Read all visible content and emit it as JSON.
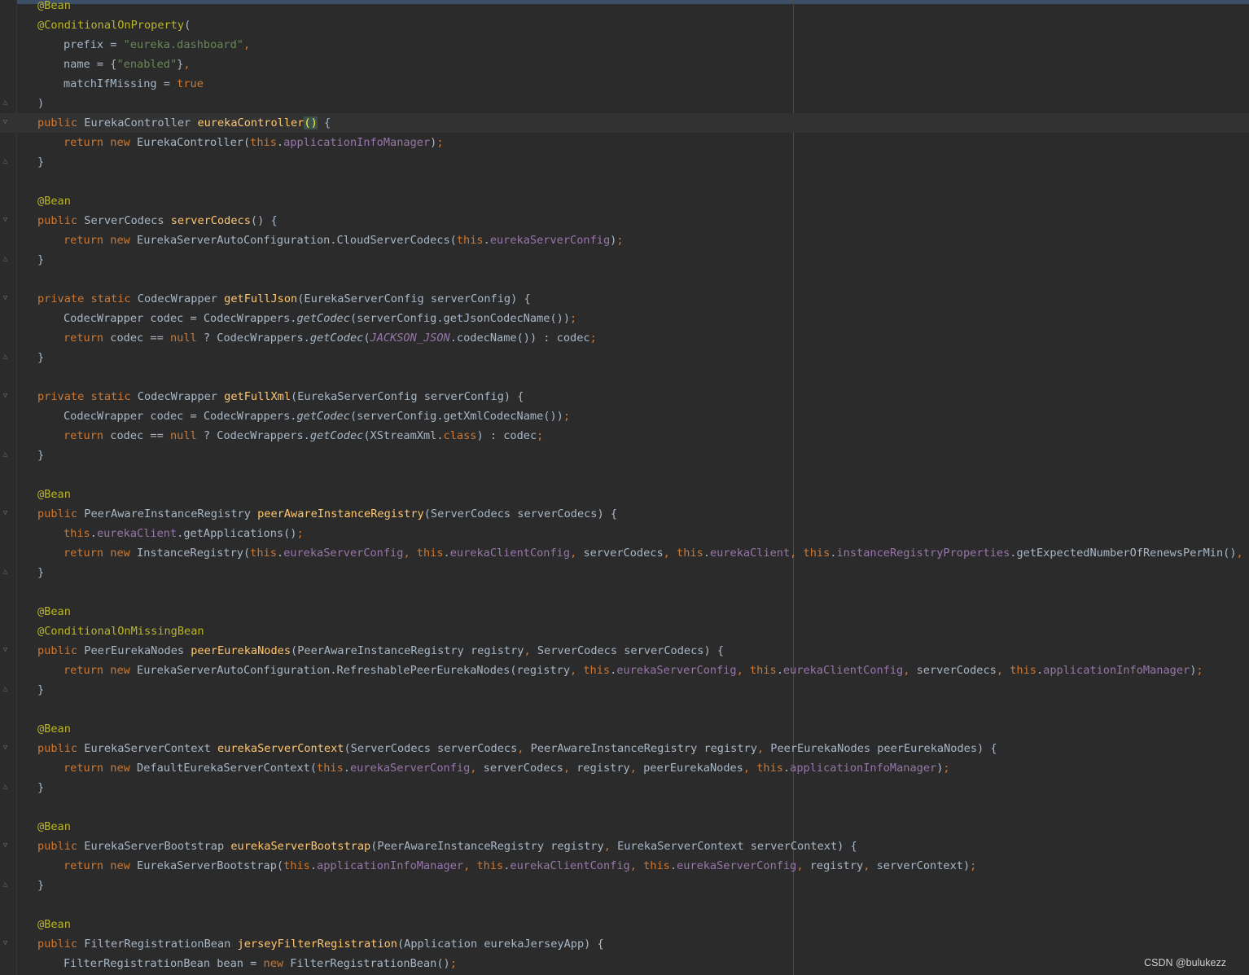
{
  "editor": {
    "current_line_index": 6,
    "lines": [
      {
        "indent": 0,
        "fold": "",
        "tokens": [
          [
            "ann",
            "@Bean"
          ]
        ]
      },
      {
        "indent": 0,
        "fold": "",
        "tokens": [
          [
            "ann",
            "@ConditionalOnProperty"
          ],
          [
            "",
            "("
          ]
        ]
      },
      {
        "indent": 1,
        "fold": "",
        "tokens": [
          [
            "",
            "prefix = "
          ],
          [
            "str",
            "\"eureka.dashboard\""
          ],
          [
            "kw",
            ","
          ]
        ]
      },
      {
        "indent": 1,
        "fold": "",
        "tokens": [
          [
            "",
            "name = {"
          ],
          [
            "str",
            "\"enabled\""
          ],
          [
            "",
            "}"
          ],
          [
            "kw",
            ","
          ]
        ]
      },
      {
        "indent": 1,
        "fold": "",
        "tokens": [
          [
            "",
            "matchIfMissing = "
          ],
          [
            "kw",
            "true"
          ]
        ]
      },
      {
        "indent": 0,
        "fold": "close",
        "tokens": [
          [
            "",
            ")"
          ]
        ]
      },
      {
        "indent": 0,
        "fold": "open",
        "tokens": [
          [
            "kw",
            "public "
          ],
          [
            "",
            "EurekaController "
          ],
          [
            "fn",
            "eurekaController"
          ],
          [
            "br",
            "()"
          ],
          [
            "",
            " {"
          ]
        ]
      },
      {
        "indent": 1,
        "fold": "",
        "tokens": [
          [
            "kw",
            "return new "
          ],
          [
            "",
            "EurekaController("
          ],
          [
            "kw",
            "this"
          ],
          [
            "",
            "."
          ],
          [
            "fld",
            "applicationInfoManager"
          ],
          [
            "",
            ")"
          ],
          [
            "kw",
            ";"
          ]
        ]
      },
      {
        "indent": 0,
        "fold": "close",
        "tokens": [
          [
            "",
            "}"
          ]
        ]
      },
      {
        "indent": 0,
        "fold": "",
        "tokens": []
      },
      {
        "indent": 0,
        "fold": "",
        "tokens": [
          [
            "ann",
            "@Bean"
          ]
        ]
      },
      {
        "indent": 0,
        "fold": "open",
        "tokens": [
          [
            "kw",
            "public "
          ],
          [
            "",
            "ServerCodecs "
          ],
          [
            "fn",
            "serverCodecs"
          ],
          [
            "",
            "() {"
          ]
        ]
      },
      {
        "indent": 1,
        "fold": "",
        "tokens": [
          [
            "kw",
            "return new "
          ],
          [
            "",
            "EurekaServerAutoConfiguration.CloudServerCodecs("
          ],
          [
            "kw",
            "this"
          ],
          [
            "",
            "."
          ],
          [
            "fld",
            "eurekaServerConfig"
          ],
          [
            "",
            ")"
          ],
          [
            "kw",
            ";"
          ]
        ]
      },
      {
        "indent": 0,
        "fold": "close",
        "tokens": [
          [
            "",
            "}"
          ]
        ]
      },
      {
        "indent": 0,
        "fold": "",
        "tokens": []
      },
      {
        "indent": 0,
        "fold": "open",
        "tokens": [
          [
            "kw",
            "private static "
          ],
          [
            "",
            "CodecWrapper "
          ],
          [
            "fn",
            "getFullJson"
          ],
          [
            "",
            "(EurekaServerConfig serverConfig) {"
          ]
        ]
      },
      {
        "indent": 1,
        "fold": "",
        "tokens": [
          [
            "",
            "CodecWrapper codec = CodecWrappers."
          ],
          [
            "sm",
            "getCodec"
          ],
          [
            "",
            "(serverConfig.getJsonCodecName())"
          ],
          [
            "kw",
            ";"
          ]
        ]
      },
      {
        "indent": 1,
        "fold": "",
        "tokens": [
          [
            "kw",
            "return "
          ],
          [
            "",
            "codec == "
          ],
          [
            "kw",
            "null "
          ],
          [
            "",
            "? CodecWrappers."
          ],
          [
            "sm",
            "getCodec"
          ],
          [
            "",
            "("
          ],
          [
            "sfld",
            "JACKSON_JSON"
          ],
          [
            "",
            ".codecName()) : codec"
          ],
          [
            "kw",
            ";"
          ]
        ]
      },
      {
        "indent": 0,
        "fold": "close",
        "tokens": [
          [
            "",
            "}"
          ]
        ]
      },
      {
        "indent": 0,
        "fold": "",
        "tokens": []
      },
      {
        "indent": 0,
        "fold": "open",
        "tokens": [
          [
            "kw",
            "private static "
          ],
          [
            "",
            "CodecWrapper "
          ],
          [
            "fn",
            "getFullXml"
          ],
          [
            "",
            "(EurekaServerConfig serverConfig) {"
          ]
        ]
      },
      {
        "indent": 1,
        "fold": "",
        "tokens": [
          [
            "",
            "CodecWrapper codec = CodecWrappers."
          ],
          [
            "sm",
            "getCodec"
          ],
          [
            "",
            "(serverConfig.getXmlCodecName())"
          ],
          [
            "kw",
            ";"
          ]
        ]
      },
      {
        "indent": 1,
        "fold": "",
        "tokens": [
          [
            "kw",
            "return "
          ],
          [
            "",
            "codec == "
          ],
          [
            "kw",
            "null "
          ],
          [
            "",
            "? CodecWrappers."
          ],
          [
            "sm",
            "getCodec"
          ],
          [
            "",
            "(XStreamXml."
          ],
          [
            "kw",
            "class"
          ],
          [
            "",
            ") : codec"
          ],
          [
            "kw",
            ";"
          ]
        ]
      },
      {
        "indent": 0,
        "fold": "close",
        "tokens": [
          [
            "",
            "}"
          ]
        ]
      },
      {
        "indent": 0,
        "fold": "",
        "tokens": []
      },
      {
        "indent": 0,
        "fold": "",
        "tokens": [
          [
            "ann",
            "@Bean"
          ]
        ]
      },
      {
        "indent": 0,
        "fold": "open",
        "tokens": [
          [
            "kw",
            "public "
          ],
          [
            "",
            "PeerAwareInstanceRegistry "
          ],
          [
            "fn",
            "peerAwareInstanceRegistry"
          ],
          [
            "",
            "(ServerCodecs serverCodecs) {"
          ]
        ]
      },
      {
        "indent": 1,
        "fold": "",
        "tokens": [
          [
            "kw",
            "this"
          ],
          [
            "",
            "."
          ],
          [
            "fld",
            "eurekaClient"
          ],
          [
            "",
            ".getApplications()"
          ],
          [
            "kw",
            ";"
          ]
        ]
      },
      {
        "indent": 1,
        "fold": "",
        "tokens": [
          [
            "kw",
            "return new "
          ],
          [
            "",
            "InstanceRegistry("
          ],
          [
            "kw",
            "this"
          ],
          [
            "",
            "."
          ],
          [
            "fld",
            "eurekaServerConfig"
          ],
          [
            "kw",
            ", this"
          ],
          [
            "",
            "."
          ],
          [
            "fld",
            "eurekaClientConfig"
          ],
          [
            "kw",
            ", "
          ],
          [
            "",
            "serverCodecs"
          ],
          [
            "kw",
            ", this"
          ],
          [
            "",
            "."
          ],
          [
            "fld",
            "eurekaClient"
          ],
          [
            "kw",
            ", this"
          ],
          [
            "",
            "."
          ],
          [
            "fld",
            "instanceRegistryProperties"
          ],
          [
            "",
            ".getExpectedNumberOfRenewsPerMin()"
          ],
          [
            "kw",
            ", this"
          ]
        ]
      },
      {
        "indent": 0,
        "fold": "close",
        "tokens": [
          [
            "",
            "}"
          ]
        ]
      },
      {
        "indent": 0,
        "fold": "",
        "tokens": []
      },
      {
        "indent": 0,
        "fold": "",
        "tokens": [
          [
            "ann",
            "@Bean"
          ]
        ]
      },
      {
        "indent": 0,
        "fold": "",
        "tokens": [
          [
            "ann",
            "@ConditionalOnMissingBean"
          ]
        ]
      },
      {
        "indent": 0,
        "fold": "open",
        "tokens": [
          [
            "kw",
            "public "
          ],
          [
            "",
            "PeerEurekaNodes "
          ],
          [
            "fn",
            "peerEurekaNodes"
          ],
          [
            "",
            "(PeerAwareInstanceRegistry registry"
          ],
          [
            "kw",
            ", "
          ],
          [
            "",
            "ServerCodecs serverCodecs) {"
          ]
        ]
      },
      {
        "indent": 1,
        "fold": "",
        "tokens": [
          [
            "kw",
            "return new "
          ],
          [
            "",
            "EurekaServerAutoConfiguration.RefreshablePeerEurekaNodes(registry"
          ],
          [
            "kw",
            ", this"
          ],
          [
            "",
            "."
          ],
          [
            "fld",
            "eurekaServerConfig"
          ],
          [
            "kw",
            ", this"
          ],
          [
            "",
            "."
          ],
          [
            "fld",
            "eurekaClientConfig"
          ],
          [
            "kw",
            ", "
          ],
          [
            "",
            "serverCodecs"
          ],
          [
            "kw",
            ", this"
          ],
          [
            "",
            "."
          ],
          [
            "fld",
            "applicationInfoManager"
          ],
          [
            "",
            ")"
          ],
          [
            "kw",
            ";"
          ]
        ]
      },
      {
        "indent": 0,
        "fold": "close",
        "tokens": [
          [
            "",
            "}"
          ]
        ]
      },
      {
        "indent": 0,
        "fold": "",
        "tokens": []
      },
      {
        "indent": 0,
        "fold": "",
        "tokens": [
          [
            "ann",
            "@Bean"
          ]
        ]
      },
      {
        "indent": 0,
        "fold": "open",
        "tokens": [
          [
            "kw",
            "public "
          ],
          [
            "",
            "EurekaServerContext "
          ],
          [
            "fn",
            "eurekaServerContext"
          ],
          [
            "",
            "(ServerCodecs serverCodecs"
          ],
          [
            "kw",
            ", "
          ],
          [
            "",
            "PeerAwareInstanceRegistry registry"
          ],
          [
            "kw",
            ", "
          ],
          [
            "",
            "PeerEurekaNodes peerEurekaNodes) {"
          ]
        ]
      },
      {
        "indent": 1,
        "fold": "",
        "tokens": [
          [
            "kw",
            "return new "
          ],
          [
            "",
            "DefaultEurekaServerContext("
          ],
          [
            "kw",
            "this"
          ],
          [
            "",
            "."
          ],
          [
            "fld",
            "eurekaServerConfig"
          ],
          [
            "kw",
            ", "
          ],
          [
            "",
            "serverCodecs"
          ],
          [
            "kw",
            ", "
          ],
          [
            "",
            "registry"
          ],
          [
            "kw",
            ", "
          ],
          [
            "",
            "peerEurekaNodes"
          ],
          [
            "kw",
            ", this"
          ],
          [
            "",
            "."
          ],
          [
            "fld",
            "applicationInfoManager"
          ],
          [
            "",
            ")"
          ],
          [
            "kw",
            ";"
          ]
        ]
      },
      {
        "indent": 0,
        "fold": "close",
        "tokens": [
          [
            "",
            "}"
          ]
        ]
      },
      {
        "indent": 0,
        "fold": "",
        "tokens": []
      },
      {
        "indent": 0,
        "fold": "",
        "tokens": [
          [
            "ann",
            "@Bean"
          ]
        ]
      },
      {
        "indent": 0,
        "fold": "open",
        "tokens": [
          [
            "kw",
            "public "
          ],
          [
            "",
            "EurekaServerBootstrap "
          ],
          [
            "fn",
            "eurekaServerBootstrap"
          ],
          [
            "",
            "(PeerAwareInstanceRegistry registry"
          ],
          [
            "kw",
            ", "
          ],
          [
            "",
            "EurekaServerContext serverContext) {"
          ]
        ]
      },
      {
        "indent": 1,
        "fold": "",
        "tokens": [
          [
            "kw",
            "return new "
          ],
          [
            "",
            "EurekaServerBootstrap("
          ],
          [
            "kw",
            "this"
          ],
          [
            "",
            "."
          ],
          [
            "fld",
            "applicationInfoManager"
          ],
          [
            "kw",
            ", this"
          ],
          [
            "",
            "."
          ],
          [
            "fld",
            "eurekaClientConfig"
          ],
          [
            "kw",
            ", this"
          ],
          [
            "",
            "."
          ],
          [
            "fld",
            "eurekaServerConfig"
          ],
          [
            "kw",
            ", "
          ],
          [
            "",
            "registry"
          ],
          [
            "kw",
            ", "
          ],
          [
            "",
            "serverContext)"
          ],
          [
            "kw",
            ";"
          ]
        ]
      },
      {
        "indent": 0,
        "fold": "close",
        "tokens": [
          [
            "",
            "}"
          ]
        ]
      },
      {
        "indent": 0,
        "fold": "",
        "tokens": []
      },
      {
        "indent": 0,
        "fold": "",
        "tokens": [
          [
            "ann",
            "@Bean"
          ]
        ]
      },
      {
        "indent": 0,
        "fold": "open",
        "tokens": [
          [
            "kw",
            "public "
          ],
          [
            "",
            "FilterRegistrationBean "
          ],
          [
            "fn",
            "jerseyFilterRegistration"
          ],
          [
            "",
            "(Application eurekaJerseyApp) {"
          ]
        ]
      },
      {
        "indent": 1,
        "fold": "",
        "tokens": [
          [
            "",
            "FilterRegistrationBean bean = "
          ],
          [
            "kw",
            "new "
          ],
          [
            "",
            "FilterRegistrationBean()"
          ],
          [
            "kw",
            ";"
          ]
        ]
      }
    ]
  },
  "watermark": "CSDN @bulukezz",
  "colors": {
    "background": "#2b2b2b",
    "keyword": "#cc7832",
    "string": "#6a8759",
    "annotation": "#bbb529",
    "method": "#ffc66d",
    "field": "#9876aa",
    "default": "#a9b7c6"
  }
}
